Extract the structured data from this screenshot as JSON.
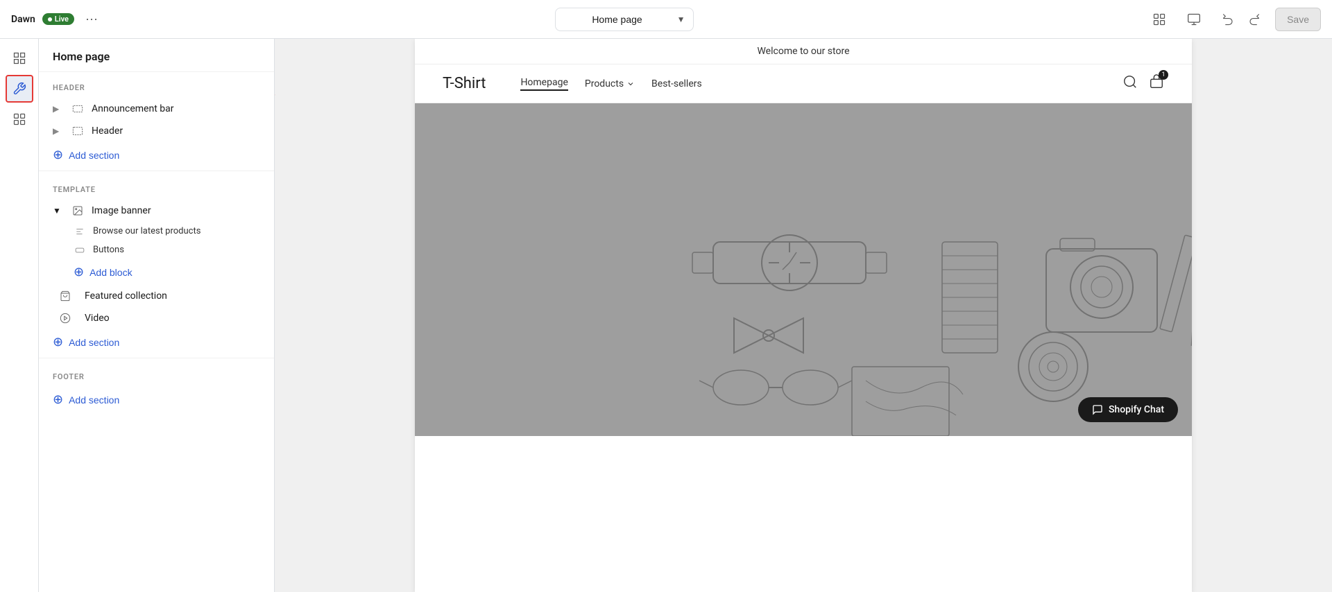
{
  "topbar": {
    "store_name": "Dawn",
    "live_label": "Live",
    "more_icon": "···",
    "page_select_value": "Home page",
    "grid_icon": "⊞",
    "desktop_icon": "🖥",
    "undo_icon": "↩",
    "redo_icon": "↪",
    "save_label": "Save"
  },
  "left_panel": {
    "title": "Home page",
    "sections": {
      "header_label": "HEADER",
      "header_items": [
        {
          "id": "announcement-bar",
          "label": "Announcement bar",
          "icon": "announcement",
          "expandable": true
        },
        {
          "id": "header",
          "label": "Header",
          "icon": "header",
          "expandable": true
        }
      ],
      "header_add_section": "Add section",
      "template_label": "TEMPLATE",
      "template_items": [
        {
          "id": "image-banner",
          "label": "Image banner",
          "icon": "image",
          "expandable": true,
          "expanded": true
        }
      ],
      "image_banner_sub_items": [
        {
          "id": "browse-latest",
          "label": "Browse our latest products",
          "icon": "text"
        },
        {
          "id": "buttons",
          "label": "Buttons",
          "icon": "button"
        }
      ],
      "image_banner_add_block": "Add block",
      "template_other_items": [
        {
          "id": "featured-collection",
          "label": "Featured collection",
          "icon": "bag"
        },
        {
          "id": "video",
          "label": "Video",
          "icon": "play"
        }
      ],
      "template_add_section": "Add section",
      "footer_label": "FOOTER",
      "footer_add_section": "Add section"
    }
  },
  "preview": {
    "announcement_text": "Welcome to our store",
    "logo": "T-Shirt",
    "nav_links": [
      {
        "label": "Homepage",
        "active": true
      },
      {
        "label": "Products",
        "has_arrow": true
      },
      {
        "label": "Best-sellers",
        "has_arrow": false
      }
    ],
    "chat_widget_label": "Shopify Chat"
  }
}
